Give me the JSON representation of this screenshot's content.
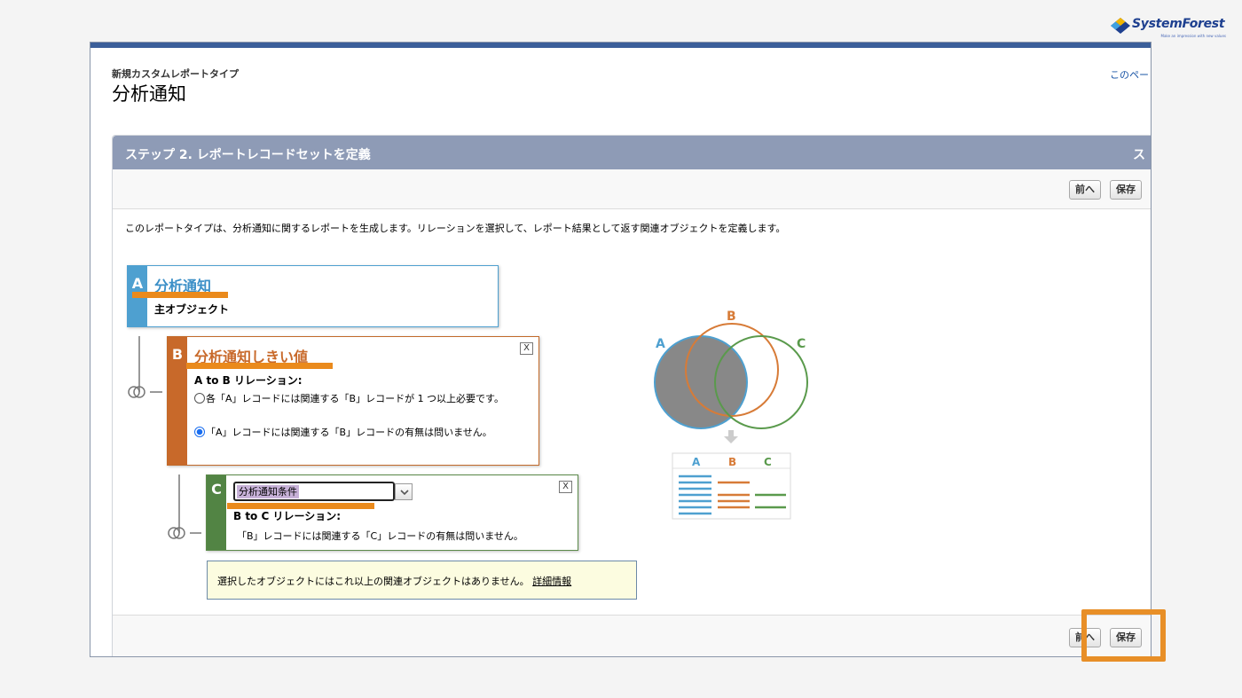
{
  "logo": {
    "name": "SystemForest",
    "tagline": "Make an impression with new values"
  },
  "page": {
    "breadcrumb": "新規カスタムレポートタイプ",
    "title": "分析通知",
    "help_link": "このペー"
  },
  "step": {
    "title": "ステップ 2. レポートレコードセットを定義",
    "right_label": "ス"
  },
  "buttons": {
    "prev": "前へ",
    "save": "保存"
  },
  "description": "このレポートタイプは、分析通知に関するレポートを生成します。リレーションを選択して、レポート結果として返す関連オブジェクトを定義します。",
  "object_a": {
    "letter": "A",
    "name": "分析通知",
    "subtitle": "主オブジェクト",
    "color": "#4ea0d0"
  },
  "object_b": {
    "letter": "B",
    "name": "分析通知しきい値",
    "relation_label": "A to B リレーション:",
    "option_1": "各「A」レコードには関連する「B」レコードが 1 つ以上必要です。",
    "option_2": "「A」レコードには関連する「B」レコードの有無は問いません。",
    "selected_option": 2,
    "close": "X",
    "color": "#c8692a"
  },
  "object_c": {
    "letter": "C",
    "select_value": "分析通知条件",
    "relation_label": "B to C リレーション:",
    "note": "「B」レコードには関連する「C」レコードの有無は問いません。",
    "close": "X",
    "color": "#528444"
  },
  "info": {
    "text": "選択したオブジェクトにはこれ以上の関連オブジェクトはありません。",
    "link": "詳細情報"
  },
  "venn": {
    "labels": [
      "A",
      "B",
      "C"
    ],
    "table_headers": [
      "A",
      "B",
      "C"
    ]
  },
  "icons": [
    "system-forest-logo-icon",
    "relation-link-icon",
    "chevron-down-icon",
    "close-icon",
    "down-arrow-icon"
  ],
  "colors": {
    "highlight": "#ea8a1c",
    "step_header": "#8e9bb6",
    "venn_a": "#4ea0d0",
    "venn_b": "#d77b37",
    "venn_c": "#5a9a4c"
  }
}
